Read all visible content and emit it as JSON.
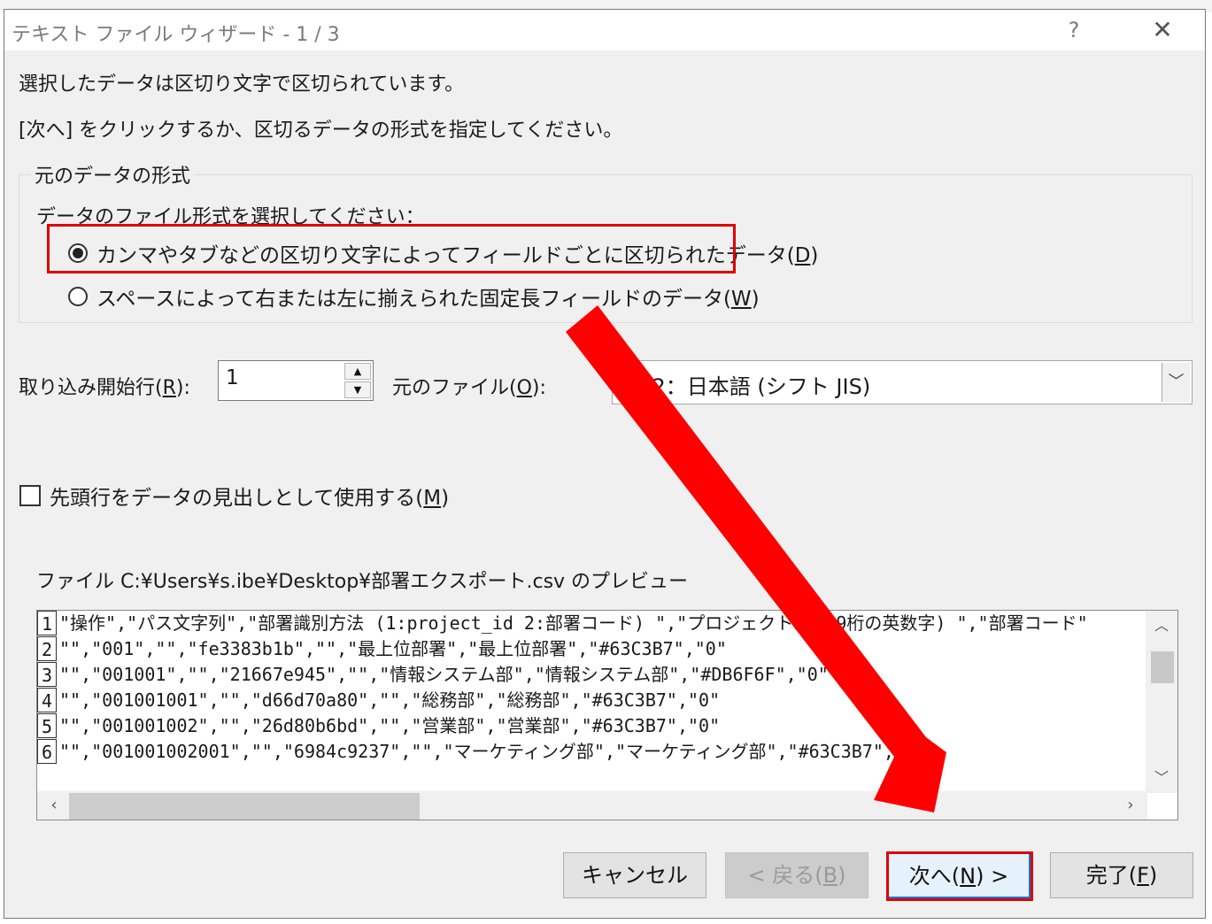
{
  "dialog": {
    "title": "テキスト ファイル ウィザード - 1 / 3",
    "help_label": "?",
    "close_label": "✕"
  },
  "intro": {
    "line1": "選択したデータは区切り文字で区切られています。",
    "line2": "[次へ] をクリックするか、区切るデータの形式を指定してください。"
  },
  "format_group": {
    "legend": "元のデータの形式",
    "prompt": "データのファイル形式を選択してください：",
    "delimited_label": "カンマやタブなどの区切り文字によってフィールドごとに区切られたデータ(",
    "delimited_key": "D",
    "delimited_selected": true,
    "fixed_label": "スペースによって右または左に揃えられた固定長フィールドのデータ(",
    "fixed_key": "W",
    "fixed_selected": false,
    "close_paren": ")"
  },
  "start_row": {
    "label": "取り込み開始行(",
    "key": "R",
    "suffix": "):",
    "value": "1",
    "up_icon": "▲",
    "down_icon": "▼"
  },
  "origin": {
    "label": "元のファイル(",
    "key": "O",
    "suffix": "):",
    "value": "932：日本語 (シフト JIS)",
    "dropdown_icon": "﹀"
  },
  "header_checkbox": {
    "label": "先頭行をデータの見出しとして使用する(",
    "key": "M",
    "suffix": ")",
    "checked": false
  },
  "preview": {
    "label": "ファイル C:¥Users¥s.ibe¥Desktop¥部署エクスポート.csv のプレビュー",
    "rows": [
      {
        "num": "1",
        "text": "\"操作\",\"パス文字列\",\"部署識別方法 (1:project_id 2:部署コード) \",\"プロジェクトID (9桁の英数字) \",\"部署コード\""
      },
      {
        "num": "2",
        "text": "\"\",\"001\",\"\",\"fe3383b1b\",\"\",\"最上位部署\",\"最上位部署\",\"#63C3B7\",\"0\""
      },
      {
        "num": "3",
        "text": "\"\",\"001001\",\"\",\"21667e945\",\"\",\"情報システム部\",\"情報システム部\",\"#DB6F6F\",\"0\""
      },
      {
        "num": "4",
        "text": "\"\",\"001001001\",\"\",\"d66d70a80\",\"\",\"総務部\",\"総務部\",\"#63C3B7\",\"0\""
      },
      {
        "num": "5",
        "text": "\"\",\"001001002\",\"\",\"26d80b6bd\",\"\",\"営業部\",\"営業部\",\"#63C3B7\",\"0\""
      },
      {
        "num": "6",
        "text": "\"\",\"001001002001\",\"\",\"6984c9237\",\"\",\"マーケティング部\",\"マーケティング部\",\"#63C3B7\",\"0\""
      }
    ],
    "scroll_up": "︿",
    "scroll_down": "﹀",
    "scroll_left": "‹",
    "scroll_right": "›"
  },
  "buttons": {
    "cancel": "キャンセル",
    "back_prefix": "< 戻る(",
    "back_key": "B",
    "back_suffix": ")",
    "next_prefix": "次へ(",
    "next_key": "N",
    "next_suffix": ") >",
    "finish_prefix": "完了(",
    "finish_key": "F",
    "finish_suffix": ")"
  },
  "annotation": {
    "highlight_color": "#e00000",
    "arrow_color": "#ff0000"
  }
}
